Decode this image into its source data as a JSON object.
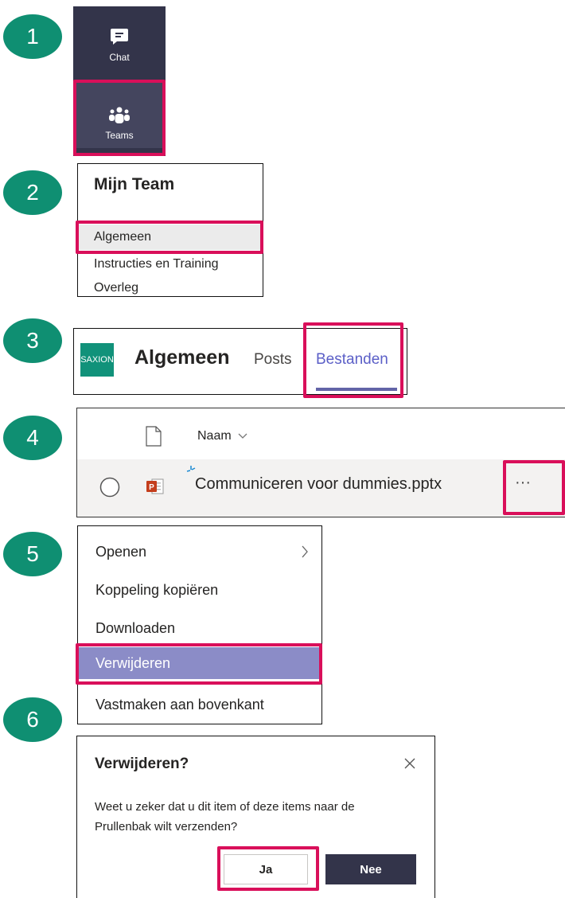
{
  "steps": [
    "1",
    "2",
    "3",
    "4",
    "5",
    "6"
  ],
  "rail": {
    "chat_label": "Chat",
    "teams_label": "Teams",
    "bg_color": "#33344a"
  },
  "channels": {
    "team_name": "Mijn Team",
    "items": [
      "Algemeen",
      "Instructies en Training",
      "Overleg"
    ]
  },
  "channel_header": {
    "logo_text": "SAXION",
    "title": "Algemeen",
    "tabs": [
      "Posts",
      "Bestanden"
    ],
    "accent": "#6264a7"
  },
  "files": {
    "column_name": "Naam",
    "sort_icon": "chevron-down-icon",
    "rows": [
      {
        "name": "Communiceren voor dummies.pptx",
        "type_icon": "powerpoint-icon"
      }
    ],
    "more_label": "···"
  },
  "context_menu": {
    "items": [
      "Openen",
      "Koppeling kopiëren",
      "Downloaden",
      "Verwijderen",
      "Vastmaken aan bovenkant"
    ],
    "selected": "Verwijderen",
    "selected_color": "#8b8cc7"
  },
  "dialog": {
    "title": "Verwijderen?",
    "message": "Weet u zeker dat u dit item of deze items naar de Prullenbak wilt verzenden?",
    "yes_label": "Ja",
    "no_label": "Nee",
    "close_icon": "close-icon"
  },
  "colors": {
    "step_badge": "#0f8f72",
    "highlight": "#d90f5a"
  }
}
